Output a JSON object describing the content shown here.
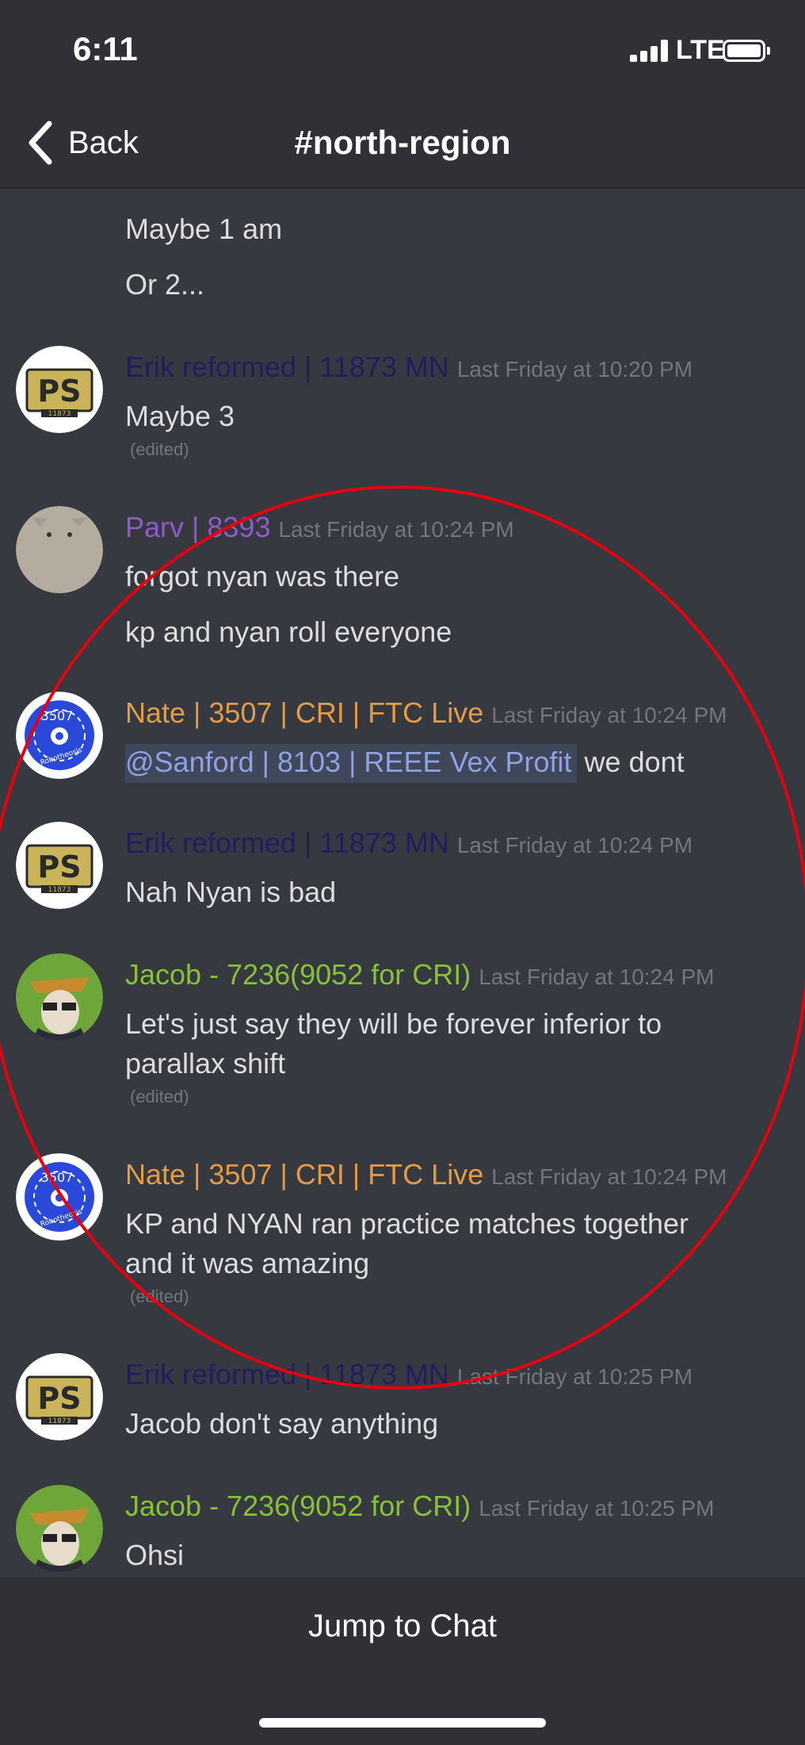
{
  "status": {
    "time": "6:11",
    "network": "LTE"
  },
  "nav": {
    "back_label": "Back",
    "channel": "#north-region"
  },
  "colors": {
    "erik": "#241c60",
    "parv": "#8e5cc8",
    "nate": "#e49b45",
    "jacob": "#86c235",
    "mention_bg": "#41475b",
    "mention_text": "#8ea1e1",
    "annotation": "#e3000f"
  },
  "messages": {
    "m0": {
      "lines": [
        "Maybe 1 am",
        "Or 2..."
      ]
    },
    "m1": {
      "author": "Erik reformed | 11873 MN",
      "time": "Last Friday at 10:20 PM",
      "lines": [
        "Maybe 3"
      ],
      "edited": "(edited)"
    },
    "m2": {
      "author": "Parv | 8393",
      "time": "Last Friday at 10:24 PM",
      "lines": [
        "forgot nyan was there",
        "kp and nyan roll everyone"
      ]
    },
    "m3": {
      "author": "Nate | 3507 | CRI | FTC Live",
      "time": "Last Friday at 10:24 PM",
      "mention": "@Sanford | 8103 | REEE Vex Profit",
      "text": " we dont"
    },
    "m4": {
      "author": "Erik reformed | 11873 MN",
      "time": "Last Friday at 10:24 PM",
      "lines": [
        "Nah Nyan is bad"
      ]
    },
    "m5": {
      "author": "Jacob - 7236(9052 for CRI)",
      "time": "Last Friday at 10:24 PM",
      "lines": [
        "Let's just say they will be forever inferior to",
        "parallax shift"
      ],
      "edited": "(edited)"
    },
    "m6": {
      "author": "Nate | 3507 | CRI | FTC Live",
      "time": "Last Friday at 10:24 PM",
      "lines": [
        "KP and NYAN ran practice matches together",
        "and it was amazing"
      ],
      "edited": "(edited)"
    },
    "m7": {
      "author": "Erik reformed | 11873 MN",
      "time": "Last Friday at 10:25 PM",
      "lines": [
        "Jacob don't say anything"
      ]
    },
    "m8": {
      "author": "Jacob - 7236(9052 for CRI)",
      "time": "Last Friday at 10:25 PM",
      "lines": [
        "Ohsi"
      ]
    }
  },
  "avatars": {
    "team_3507": "3507",
    "team_3507_sub": "Robotheosis",
    "ps_logo": "PS",
    "ps_sub": "11873"
  },
  "footer": {
    "jump_label": "Jump to Chat"
  }
}
